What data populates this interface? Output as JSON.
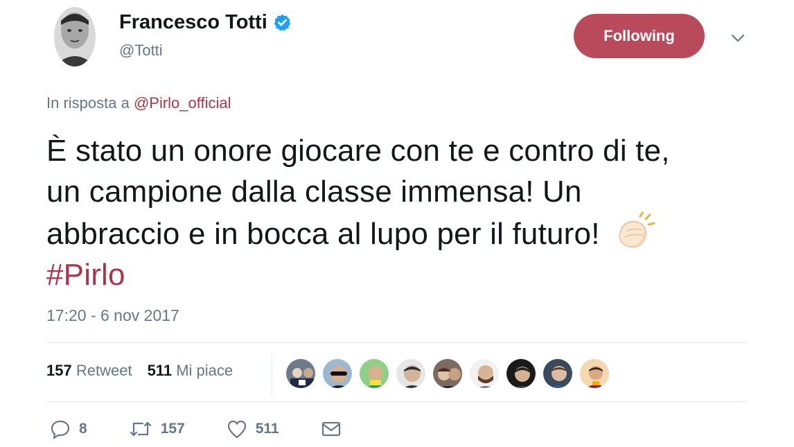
{
  "author": {
    "display_name": "Francesco Totti",
    "handle": "@Totti",
    "verified_icon": "verified-badge-icon"
  },
  "follow_button": {
    "label": "Following",
    "color": "#b94a5c"
  },
  "reply_to": {
    "prefix": "In risposta a ",
    "user": "@Pirlo_official"
  },
  "tweet": {
    "line1": "È stato un onore giocare con te e contro di te,",
    "line2": "un campione dalla classe immensa! Un",
    "line3": "abbraccio e in bocca al lupo per il futuro!",
    "emoji": "clapping-hands-icon",
    "hashtag": "#Pirlo"
  },
  "timestamp": "17:20 - 6 nov 2017",
  "stats": {
    "retweets_count": "157",
    "retweets_label": "Retweet",
    "likes_count": "511",
    "likes_label": "Mi piace"
  },
  "likers": [
    "avatar-1",
    "avatar-2",
    "avatar-3",
    "avatar-4",
    "avatar-5",
    "avatar-6",
    "avatar-7",
    "avatar-8",
    "avatar-9"
  ],
  "actions": {
    "replies": "8",
    "retweets": "157",
    "likes": "511"
  },
  "colors": {
    "accent": "#a8364a",
    "muted": "#657786",
    "verified": "#1da1f2"
  }
}
